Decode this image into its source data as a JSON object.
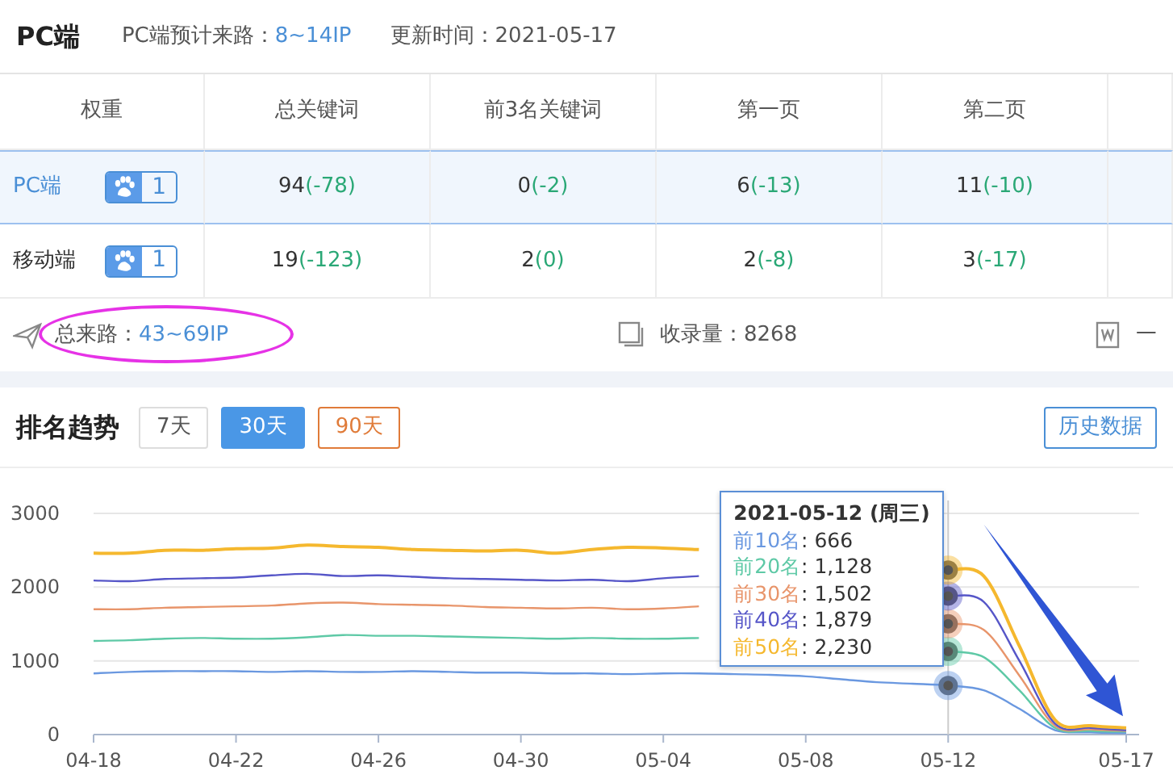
{
  "header": {
    "title": "PC端",
    "estimate": {
      "label": "PC端预计来路：",
      "value": "8~14IP"
    },
    "updated": "更新时间：2021-05-17"
  },
  "table": {
    "columns": [
      "权重",
      "总关键词",
      "前3名关键词",
      "第一页",
      "第二页"
    ],
    "rows": [
      {
        "selected": true,
        "cells": [
          {
            "kind": "platform",
            "label": "PC端",
            "badge": "1"
          },
          {
            "kind": "count",
            "value": "94",
            "change": "(-78)"
          },
          {
            "kind": "count",
            "value": "0",
            "change": "(-2)"
          },
          {
            "kind": "count",
            "value": "6",
            "change": "(-13)"
          },
          {
            "kind": "count",
            "value": "11",
            "change": "(-10)"
          }
        ]
      },
      {
        "selected": false,
        "cells": [
          {
            "kind": "platform",
            "label": "移动端",
            "badge": "1"
          },
          {
            "kind": "count",
            "value": "19",
            "change": "(-123)"
          },
          {
            "kind": "count",
            "value": "2",
            "change": "(0)"
          },
          {
            "kind": "count",
            "value": "2",
            "change": "(-8)"
          },
          {
            "kind": "count",
            "value": "3",
            "change": "(-17)"
          }
        ]
      }
    ]
  },
  "summary": [
    {
      "kind": "traffic",
      "label": "总来路：",
      "value": "43~69IP",
      "highlighted": true
    },
    {
      "kind": "indexed",
      "label": "收录量：",
      "value": "8268",
      "highlighted": false
    },
    {
      "kind": "word",
      "label": "一",
      "highlighted": false
    }
  ],
  "trend": {
    "title": "排名趋势",
    "ranges": [
      {
        "label": "7天",
        "selected": false,
        "kind": "plain"
      },
      {
        "label": "30天",
        "selected": true,
        "kind": "plain"
      },
      {
        "label": "90天",
        "selected": false,
        "kind": "warning"
      }
    ],
    "history_button": "历史数据",
    "chart_data": {
      "type": "line",
      "categories": [
        "04-18",
        null,
        null,
        null,
        "04-22",
        null,
        null,
        null,
        "04-26",
        null,
        null,
        null,
        "04-30",
        null,
        null,
        null,
        "05-04",
        null,
        null,
        null,
        "05-08",
        null,
        null,
        null,
        "05-12",
        null,
        null,
        null,
        null,
        "05-17"
      ],
      "ylim": [
        0,
        3000
      ],
      "yticks": [
        0,
        1000,
        2000,
        3000
      ],
      "series": [
        {
          "name": "前10名",
          "color": "#6a98e0",
          "values": [
            830,
            850,
            860,
            860,
            860,
            850,
            860,
            850,
            850,
            860,
            850,
            840,
            840,
            830,
            830,
            820,
            830,
            830,
            820,
            810,
            790,
            750,
            710,
            690,
            666,
            600,
            350,
            60,
            30,
            20
          ]
        },
        {
          "name": "前20名",
          "color": "#5ec9a6",
          "values": [
            1270,
            1280,
            1300,
            1310,
            1300,
            1300,
            1320,
            1350,
            1340,
            1340,
            1330,
            1320,
            1310,
            1300,
            1310,
            1300,
            1300,
            1310,
            null,
            null,
            null,
            null,
            null,
            null,
            1128,
            1050,
            600,
            90,
            50,
            40
          ]
        },
        {
          "name": "前30名",
          "color": "#e8956b",
          "values": [
            1700,
            1700,
            1720,
            1730,
            1740,
            1750,
            1780,
            1790,
            1770,
            1760,
            1750,
            1730,
            1720,
            1710,
            1720,
            1700,
            1710,
            1740,
            null,
            null,
            null,
            null,
            null,
            null,
            1502,
            1420,
            800,
            120,
            70,
            50
          ]
        },
        {
          "name": "前40名",
          "color": "#5656c8",
          "values": [
            2090,
            2080,
            2110,
            2120,
            2130,
            2160,
            2180,
            2150,
            2160,
            2140,
            2120,
            2110,
            2100,
            2090,
            2100,
            2080,
            2120,
            2150,
            null,
            null,
            null,
            null,
            null,
            null,
            1879,
            1800,
            1000,
            150,
            90,
            60
          ]
        },
        {
          "name": "前50名",
          "color": "#f5b82e",
          "values": [
            2460,
            2460,
            2500,
            2500,
            2520,
            2530,
            2570,
            2550,
            2540,
            2510,
            2500,
            2490,
            2500,
            2460,
            2510,
            2540,
            2530,
            2510,
            null,
            null,
            null,
            null,
            null,
            null,
            2230,
            2150,
            1200,
            200,
            120,
            90
          ]
        }
      ]
    },
    "tooltip": {
      "title": "2021-05-12 (周三)",
      "rows": [
        {
          "value": ": 666"
        },
        {
          "value": ": 1,128"
        },
        {
          "value": ": 1,502"
        },
        {
          "value": ": 1,879"
        },
        {
          "value": ": 2,230"
        }
      ]
    }
  }
}
